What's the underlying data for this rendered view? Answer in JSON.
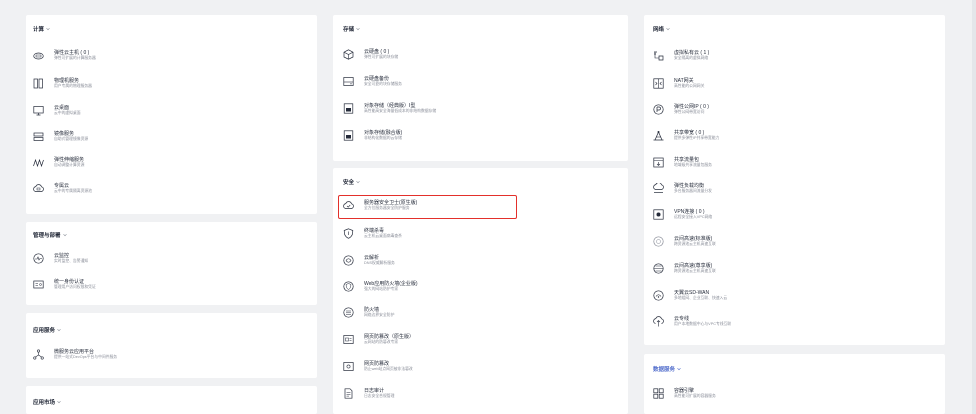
{
  "columns": {
    "left": {
      "sections": [
        {
          "title": "计算",
          "items": [
            {
              "name": "弹性云主机 ( 0 )",
              "desc": "弹性可扩展的计算服务器",
              "icon": "cloud-server-icon"
            },
            {
              "name": "物理机服务",
              "desc": "用户专属的物理服务器",
              "icon": "physical-machine-icon"
            },
            {
              "name": "云桌面",
              "desc": "云中的虚拟桌面",
              "icon": "desktop-icon"
            },
            {
              "name": "镜像服务",
              "desc": "自助式管理镜像资源",
              "icon": "image-service-icon"
            },
            {
              "name": "弹性伸缩服务",
              "desc": "自动调整计算资源",
              "icon": "auto-scaling-icon"
            },
            {
              "name": "专属云",
              "desc": "云中的专属隔离资源池",
              "icon": "dedicated-cloud-icon"
            }
          ]
        },
        {
          "title": "管理与部署",
          "items": [
            {
              "name": "云监控",
              "desc": "实时监控、告警通知",
              "icon": "cloud-monitor-icon"
            },
            {
              "name": "统一身份认证",
              "desc": "管理用户访问权限和凭证",
              "icon": "identity-auth-icon"
            }
          ]
        },
        {
          "title": "应用服务",
          "items": [
            {
              "name": "微服务云应用平台",
              "desc": "提供一站式DevOps平台与中间件服务",
              "icon": "microservice-platform-icon"
            }
          ]
        },
        {
          "title": "应用市场",
          "items": []
        }
      ]
    },
    "middle": {
      "sections": [
        {
          "title": "存储",
          "items": [
            {
              "name": "云硬盘 ( 0 )",
              "desc": "弹性可扩展的块存储",
              "icon": "cloud-disk-icon"
            },
            {
              "name": "云硬盘备份",
              "desc": "安全可靠的块存储服务",
              "icon": "disk-backup-icon"
            },
            {
              "name": "对象存储（经典版）Ⅰ型",
              "desc": "高性能高安全海量低成本的非结构数据存储",
              "icon": "object-storage-classic-icon"
            },
            {
              "name": "对象存储(融合版)",
              "desc": "非结构化数据的云存储",
              "icon": "object-storage-fusion-icon"
            }
          ]
        },
        {
          "title": "安全",
          "items": [
            {
              "name": "服务器安全卫士(原生版)",
              "desc": "全方位服务器安全防护服务",
              "icon": "server-security-icon",
              "highlighted": true
            },
            {
              "name": "终端杀毒",
              "desc": "云主机云桌面病毒查杀",
              "icon": "antivirus-icon"
            },
            {
              "name": "云解析",
              "desc": "DNS权威解析服务",
              "icon": "cloud-dns-icon"
            },
            {
              "name": "Web应用防火墙(企业版)",
              "desc": "强大的网站防护专家",
              "icon": "web-firewall-icon"
            },
            {
              "name": "防火墙",
              "desc": "网络边界安全防护",
              "icon": "firewall-icon"
            },
            {
              "name": "网页防篡改（原生版）",
              "desc": "云网站的防篡改专家",
              "icon": "anti-tamper-native-icon"
            },
            {
              "name": "网页防篡改",
              "desc": "防止web站点网页被非法篡改",
              "icon": "anti-tamper-icon"
            },
            {
              "name": "日志审计",
              "desc": "日志安全合规管理",
              "icon": "log-audit-icon"
            }
          ]
        }
      ]
    },
    "right": {
      "sections": [
        {
          "title": "网络",
          "items": [
            {
              "name": "虚拟私有云 ( 1 )",
              "desc": "安全隔离的虚拟网络",
              "icon": "vpc-icon"
            },
            {
              "name": "NAT网关",
              "desc": "高性能的公网网关",
              "icon": "nat-gateway-icon"
            },
            {
              "name": "弹性公网IP ( 0 )",
              "desc": "弹性公网带宽访问",
              "icon": "elastic-ip-icon"
            },
            {
              "name": "共享带宽 ( 0 )",
              "desc": "提供多弹性IP共享带宽能力",
              "icon": "shared-bandwidth-icon"
            },
            {
              "name": "共享流量包",
              "desc": "地域级共享流量包服务",
              "icon": "shared-traffic-icon"
            },
            {
              "name": "弹性负载均衡",
              "desc": "多台服务器间流量分发",
              "icon": "load-balancer-icon"
            },
            {
              "name": "VPN连接 ( 0 )",
              "desc": "远程安全接入VPC网络",
              "icon": "vpn-icon"
            },
            {
              "name": "云间高速(标准版)",
              "desc": "跨资源池云主机高速互联",
              "icon": "cloud-express-standard-icon"
            },
            {
              "name": "云间高速(尊享版)",
              "desc": "跨资源池云主机高速互联",
              "icon": "cloud-express-premium-icon"
            },
            {
              "name": "天翼云SD-WAN",
              "desc": "多地组网、企业互联、快速入云",
              "icon": "sd-wan-icon"
            },
            {
              "name": "云专线",
              "desc": "用户本地数据中心与VPC专线互联",
              "icon": "direct-connect-icon"
            }
          ]
        },
        {
          "title": "数据服务",
          "items": [
            {
              "name": "容器引擎",
              "desc": "高性能可扩展的容器服务",
              "icon": "container-engine-icon"
            }
          ]
        }
      ]
    }
  },
  "colors": {
    "highlight_border": "#e3302b",
    "section_title_accent": "#526ecc"
  }
}
